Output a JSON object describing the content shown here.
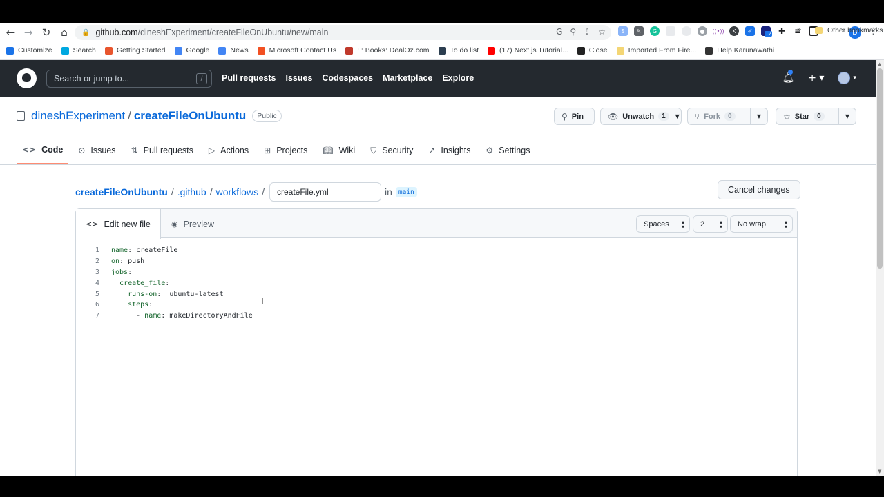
{
  "browser": {
    "url_host": "github.com",
    "url_path": "/dineshExperiment/createFileOnUbuntu/new/main",
    "profile_letter": "D",
    "bookmarks": [
      {
        "label": "Customize",
        "color": "#1a73e8"
      },
      {
        "label": "Search",
        "color": "#00a8e0"
      },
      {
        "label": "Getting Started",
        "color": "#e8552d"
      },
      {
        "label": "Google",
        "color": "#4285f4"
      },
      {
        "label": "News",
        "color": "#4285f4"
      },
      {
        "label": "Microsoft Contact Us",
        "color": "#f25022"
      },
      {
        "label": ": : Books: DealOz.com",
        "color": "#c0392b"
      },
      {
        "label": "To do list",
        "color": "#2c3e50"
      },
      {
        "label": "(17) Next.js Tutorial...",
        "color": "#ff0000"
      },
      {
        "label": "Close",
        "color": "#222222"
      },
      {
        "label": "Imported From Fire...",
        "color": "#f4d675"
      },
      {
        "label": "Help Karunawathi",
        "color": "#333333"
      }
    ],
    "bookmarks_more": "»",
    "other_bookmarks": "Other bookmarks",
    "extension_badge": "12"
  },
  "github": {
    "search_placeholder": "Search or jump to...",
    "search_key": "/",
    "nav": [
      "Pull requests",
      "Issues",
      "Codespaces",
      "Marketplace",
      "Explore"
    ]
  },
  "repo": {
    "owner": "dineshExperiment",
    "name": "createFileOnUbuntu",
    "visibility": "Public",
    "pin_label": "Pin",
    "unwatch_label": "Unwatch",
    "unwatch_count": "1",
    "fork_label": "Fork",
    "fork_count": "0",
    "star_label": "Star",
    "star_count": "0",
    "tabs": [
      "Code",
      "Issues",
      "Pull requests",
      "Actions",
      "Projects",
      "Wiki",
      "Security",
      "Insights",
      "Settings"
    ]
  },
  "editor": {
    "crumb_root": "createFileOnUbuntu",
    "crumb_dir1": ".github",
    "crumb_dir2": "workflows",
    "filename": "createFile.yml",
    "in_label": "in",
    "branch": "main",
    "cancel_label": "Cancel changes",
    "tab_edit": "Edit new file",
    "tab_preview": "Preview",
    "indent_mode": "Spaces",
    "indent_size": "2",
    "wrap_mode": "No wrap",
    "lines": [
      {
        "num": "1",
        "indent": "",
        "key": "name",
        "value": " createFile"
      },
      {
        "num": "2",
        "indent": "",
        "key": "on",
        "value": " push"
      },
      {
        "num": "3",
        "indent": "",
        "key": "jobs",
        "value": ""
      },
      {
        "num": "4",
        "indent": "  ",
        "key": "create_file",
        "value": ""
      },
      {
        "num": "5",
        "indent": "    ",
        "key": "runs-on",
        "value": "  ubuntu-latest"
      },
      {
        "num": "6",
        "indent": "    ",
        "key": "steps",
        "value": ""
      },
      {
        "num": "7",
        "indent": "      - ",
        "key": "name",
        "value": " makeDirectoryAndFile"
      }
    ]
  }
}
